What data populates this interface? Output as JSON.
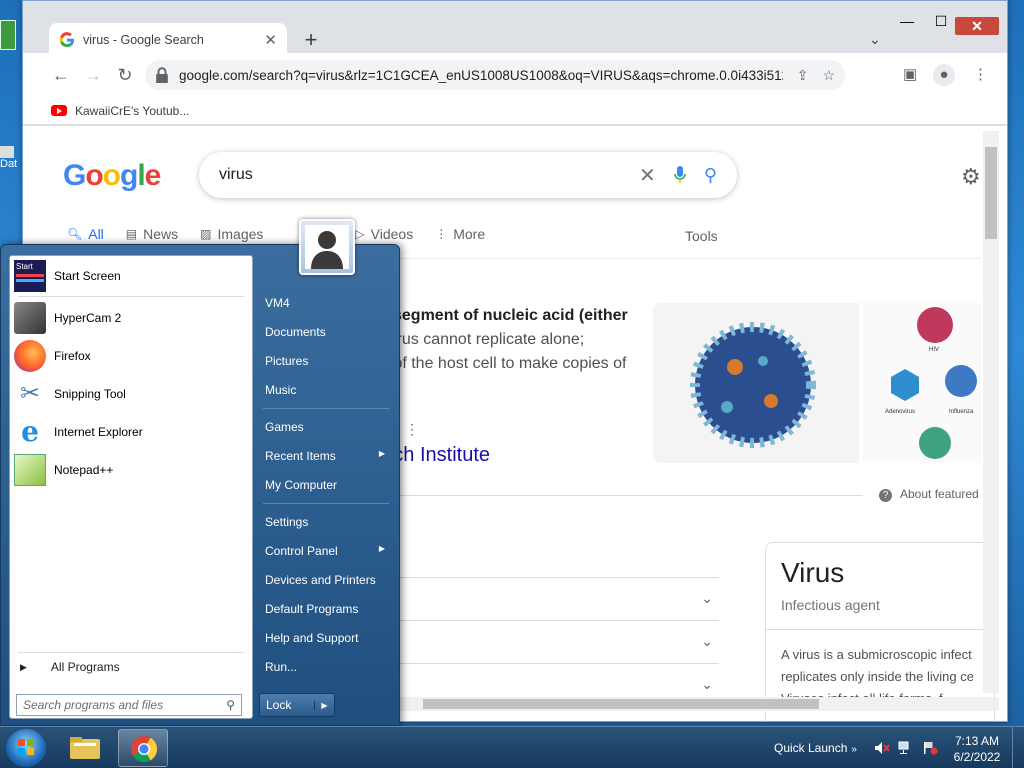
{
  "desktop": {
    "icon_label": "Dat"
  },
  "browser": {
    "tab": {
      "title": "virus - Google Search"
    },
    "address": {
      "url": "google.com/search?q=virus&rlz=1C1GCEA_enUS1008US1008&oq=VIRUS&aqs=chrome.0.0i433i512j0i..."
    },
    "bookmark": {
      "label": "KawaiiCrE's Youtub..."
    }
  },
  "google": {
    "logo": "Google",
    "query": "virus",
    "tabs": [
      {
        "label": "All",
        "icon": "search-icon"
      },
      {
        "label": "News",
        "icon": "news-icon"
      },
      {
        "label": "Images",
        "icon": "image-icon"
      },
      {
        "label": "Videos",
        "icon": "play-icon"
      },
      {
        "label": "More",
        "icon": "vertical-dots-icon"
      }
    ],
    "tools": "Tools",
    "snippet": {
      "bold": "segment of nucleic acid (either",
      "line2": "irus cannot replicate alone;",
      "line3": "s of the host cell to make copies of"
    },
    "source_link": "he Research Institute",
    "about": "About featured",
    "knowledge_panel": {
      "title": "Virus",
      "subtitle": "Infectious agent",
      "desc1": "A virus is a submicroscopic infect",
      "desc2": "replicates only inside the living ce",
      "desc3": "Viruses infect all life forms, f"
    },
    "image_labels": [
      "HIV",
      "Adenovirus",
      "Influenza"
    ]
  },
  "start_menu": {
    "programs": [
      {
        "label": "Start Screen",
        "icon": "start-screen-icon"
      },
      {
        "label": "HyperCam 2",
        "icon": "hypercam-icon"
      },
      {
        "label": "Firefox",
        "icon": "firefox-icon"
      },
      {
        "label": "Snipping Tool",
        "icon": "scissors-icon"
      },
      {
        "label": "Internet Explorer",
        "icon": "ie-icon"
      },
      {
        "label": "Notepad++",
        "icon": "notepad-icon"
      }
    ],
    "all_programs": "All Programs",
    "search_placeholder": "Search programs and files",
    "right": {
      "user": "VM4",
      "documents": "Documents",
      "pictures": "Pictures",
      "music": "Music",
      "games": "Games",
      "recent_items": "Recent Items",
      "my_computer": "My Computer",
      "settings": "Settings",
      "control_panel": "Control Panel",
      "devices_printers": "Devices and Printers",
      "default_programs": "Default Programs",
      "help_support": "Help and Support",
      "run": "Run..."
    },
    "lock": "Lock"
  },
  "taskbar": {
    "quick_launch": "Quick Launch",
    "time": "7:13 AM",
    "date": "6/2/2022"
  },
  "colors": {
    "google_blue": "#4285F4",
    "google_red": "#EA4335",
    "google_yellow": "#FBBC05",
    "google_green": "#34A853",
    "link": "#1a0dab"
  }
}
